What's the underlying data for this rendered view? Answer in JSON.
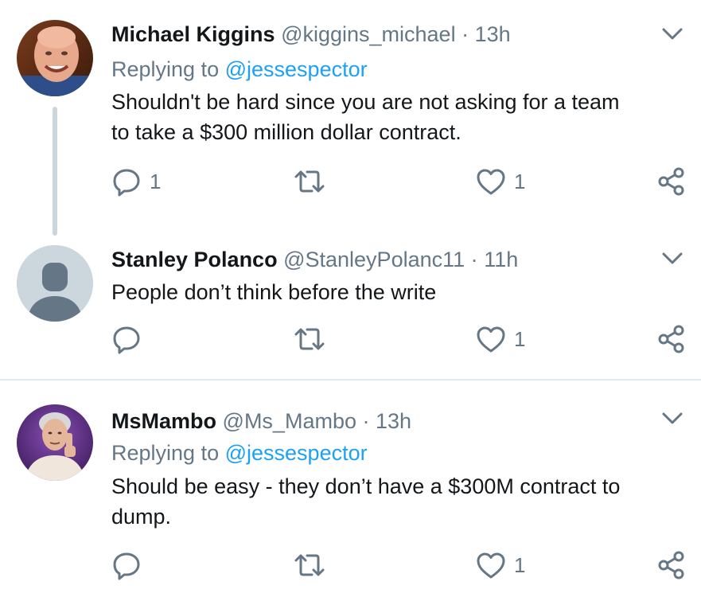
{
  "tweets": [
    {
      "name": "Michael Kiggins",
      "handle": "@kiggins_michael",
      "separator": "·",
      "time": "13h",
      "replying_prefix": "Replying to",
      "replying_to": "@jessespector",
      "text_lines": [
        "Shouldn't be hard since you are not asking for a team",
        "to take a $300 million dollar contract."
      ],
      "reply_count": "1",
      "like_count": "1",
      "avatar": "photo-bald-man"
    },
    {
      "name": "Stanley Polanco",
      "handle": "@StanleyPolanc11",
      "separator": "·",
      "time": "11h",
      "text_lines": [
        "People don’t think before the write"
      ],
      "reply_count": "",
      "like_count": "1",
      "avatar": "default-person"
    },
    {
      "name": "MsMambo",
      "handle": "@Ms_Mambo",
      "separator": "·",
      "time": "13h",
      "replying_prefix": "Replying to",
      "replying_to": "@jessespector",
      "text_lines": [
        "Should be easy - they don’t have a $300M contract to",
        "dump."
      ],
      "reply_count": "",
      "like_count": "1",
      "avatar": "photo-older-woman"
    }
  ],
  "icons": {
    "reply": "reply-icon",
    "retweet": "retweet-icon",
    "like": "heart-icon",
    "share": "share-icon",
    "more": "chevron-down-icon"
  },
  "colors": {
    "text": "#14171a",
    "secondary": "#657786",
    "link": "#1da1f2",
    "divider": "#e1e8ed",
    "thread_line": "#ccd6dd"
  }
}
